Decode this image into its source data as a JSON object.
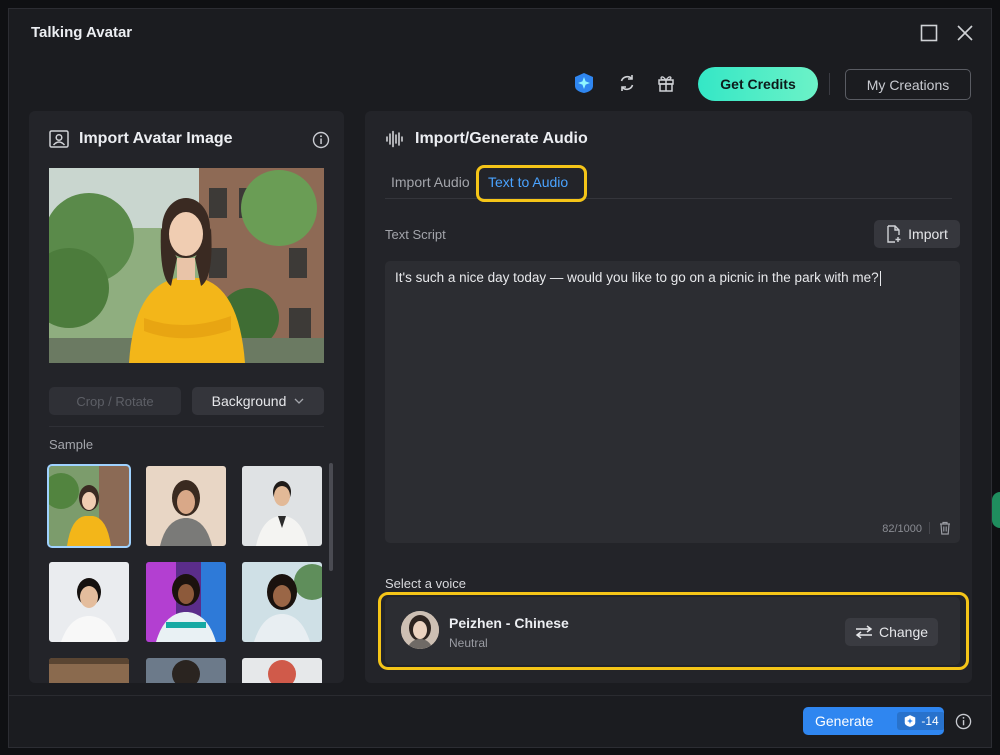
{
  "window": {
    "title": "Talking Avatar"
  },
  "toolbar": {
    "get_credits": "Get Credits",
    "my_creations": "My Creations"
  },
  "left_panel": {
    "title": "Import Avatar Image",
    "crop_rotate": "Crop / Rotate",
    "background": "Background",
    "sample_label": "Sample"
  },
  "right_panel": {
    "title": "Import/Generate Audio",
    "tabs": [
      {
        "label": "Import Audio",
        "active": false
      },
      {
        "label": "Text to Audio",
        "active": true
      }
    ],
    "script_label": "Text Script",
    "import_label": "Import",
    "script_text": "It's such a nice day today — would you like to go on a picnic in the park with me?",
    "char_count": "82/1000",
    "voice_label": "Select a voice",
    "voice": {
      "name": "Peizhen - Chinese",
      "style": "Neutral"
    },
    "change_label": "Change"
  },
  "footer": {
    "generate_label": "Generate",
    "generate_cost": "-14"
  },
  "colors": {
    "accent": "#2f86f0",
    "credits": "#34e7c6",
    "highlight": "#f5c518",
    "active_tab": "#4aa3ff"
  }
}
